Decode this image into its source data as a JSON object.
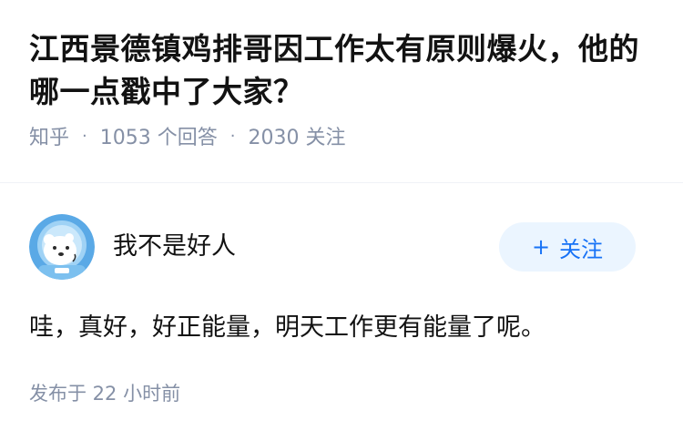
{
  "question": {
    "title": "江西景德镇鸡排哥因工作太有原则爆火，他的哪一点戳中了大家？",
    "source": "知乎",
    "answer_count": "1053 个回答",
    "follower_count": "2030 关注",
    "separator": "·"
  },
  "answer": {
    "author_name": "我不是好人",
    "avatar_icon": "polar-bear-astronaut-avatar-icon",
    "follow_plus": "+",
    "follow_label": "关注",
    "content": "哇，真好，好正能量，明天工作更有能量了呢。",
    "publish_time": "发布于 22 小时前"
  },
  "colors": {
    "accent": "#1772f6",
    "follow_bg": "#ebf5ff",
    "meta_text": "#8590a6",
    "avatar_bg": "#5aa9e6"
  }
}
